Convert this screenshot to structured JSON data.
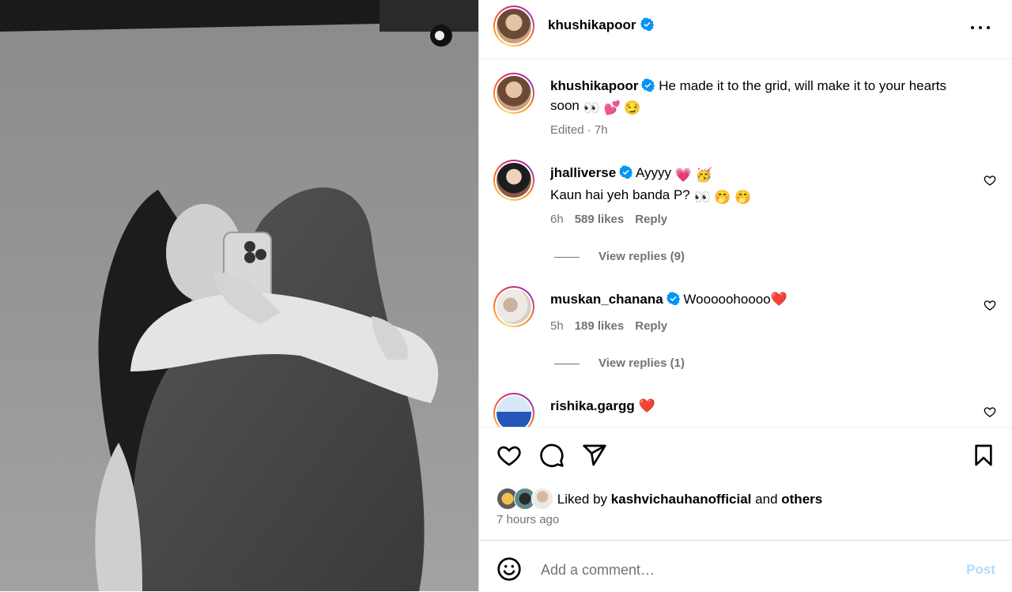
{
  "post": {
    "author": "khushikapoor",
    "caption": "He made it to the grid, will make it to your hearts soon",
    "caption_emojis": "👀 💕 😏",
    "caption_meta": "Edited · 7h"
  },
  "comments": [
    {
      "user": "jhalliverse",
      "verified": true,
      "line1": "Ayyyy",
      "line1_emojis": "💗 🥳",
      "line2": "Kaun hai yeh banda P?",
      "line2_emojis": "👀 🤭 🤭",
      "time": "6h",
      "likes": "589 likes",
      "reply_label": "Reply",
      "view_replies": "View replies (9)"
    },
    {
      "user": "muskan_chanana",
      "verified": true,
      "text": "Woooooh",
      "text_tail": "oooo❤️",
      "time": "5h",
      "likes": "189 likes",
      "reply_label": "Reply",
      "view_replies": "View replies (1)"
    },
    {
      "user": "rishika.gargg",
      "verified": false,
      "text": "❤️"
    }
  ],
  "liked_by": {
    "prefix": "Liked by",
    "user": "kashvichauhanofficial",
    "and": "and",
    "others": "others"
  },
  "time_ago": "7 hours ago",
  "add_comment": {
    "placeholder": "Add a comment…",
    "post_label": "Post"
  },
  "colors": {
    "verified": "#0095f6",
    "post_disabled": "#b3dbff",
    "muted": "#737373"
  },
  "icons": {
    "more": "more-horizontal-icon",
    "like": "heart-icon",
    "comment": "comment-icon",
    "share": "share-icon",
    "save": "bookmark-icon",
    "emoji": "emoji-icon"
  }
}
